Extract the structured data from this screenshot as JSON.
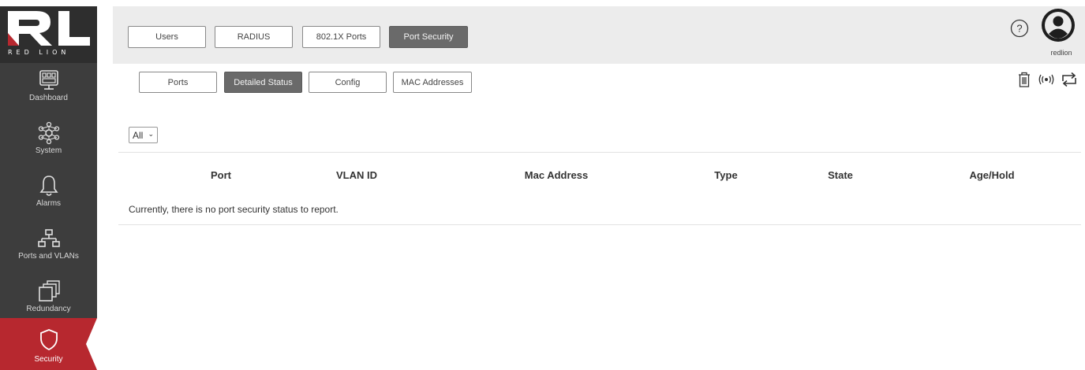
{
  "brand": {
    "logo_text": "RED LION",
    "logo_letters": "RL"
  },
  "sidebar": {
    "items": [
      {
        "label": "Dashboard",
        "icon": "dashboard-icon"
      },
      {
        "label": "System",
        "icon": "system-icon"
      },
      {
        "label": "Alarms",
        "icon": "bell-icon"
      },
      {
        "label": "Ports and VLANs",
        "icon": "network-icon"
      },
      {
        "label": "Redundancy",
        "icon": "redundancy-icon"
      },
      {
        "label": "Security",
        "icon": "shield-icon",
        "active": true
      }
    ]
  },
  "top_tabs": [
    {
      "label": "Users"
    },
    {
      "label": "RADIUS"
    },
    {
      "label": "802.1X Ports"
    },
    {
      "label": "Port Security",
      "active": true
    }
  ],
  "header": {
    "user": "redlion",
    "help_icon": "help-icon",
    "avatar_icon": "user-avatar-icon"
  },
  "sub_tabs": [
    {
      "label": "Ports"
    },
    {
      "label": "Detailed Status",
      "active": true
    },
    {
      "label": "Config"
    },
    {
      "label": "MAC Addresses"
    }
  ],
  "toolbar": {
    "icons": [
      "trash-icon",
      "broadcast-icon",
      "refresh-icon"
    ]
  },
  "filter": {
    "selected": "All"
  },
  "table": {
    "columns": [
      "Port",
      "VLAN ID",
      "Mac Address",
      "Type",
      "State",
      "Age/Hold"
    ],
    "empty_message": "Currently, there is no port security status to report."
  },
  "colors": {
    "sidebar_bg": "#3d3d3d",
    "active_red": "#b7282f",
    "topbar_bg": "#ececec",
    "active_tab": "#6a6a6a"
  }
}
